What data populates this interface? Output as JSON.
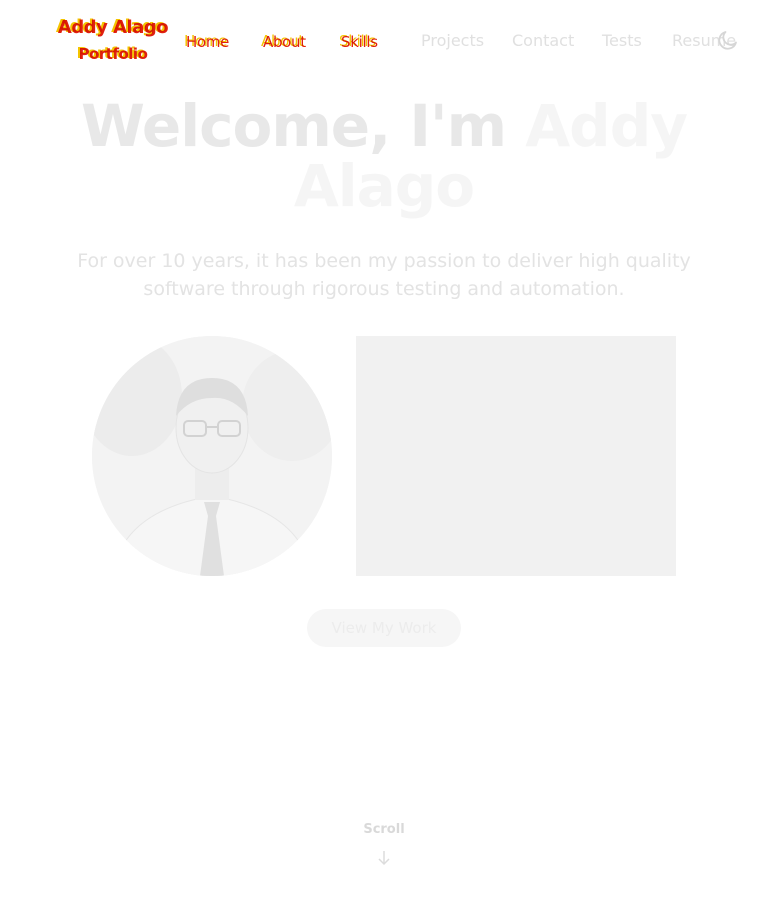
{
  "header": {
    "logo": {
      "line1": "Addy Alago",
      "line2": "Portfolio"
    },
    "nav": [
      {
        "label": "Home"
      },
      {
        "label": "About"
      },
      {
        "label": "Skills"
      },
      {
        "label": "Projects"
      },
      {
        "label": "Contact"
      },
      {
        "label": "Tests"
      },
      {
        "label": "Resume"
      }
    ],
    "theme_toggle_icon": "moon-icon"
  },
  "hero": {
    "title_prefix": "Welcome, I'm ",
    "title_name": "Addy Alago",
    "subtitle": "For over 10 years, it has been my passion to deliver high quality software through rigorous testing and automation.",
    "cta_label": "View My Work"
  },
  "scroll": {
    "label": "Scroll",
    "icon": "arrow-down-icon"
  },
  "colors": {
    "logo_primary": "#f4c400",
    "logo_shadow": "#e02010",
    "nav_faded": "#e0e0e0",
    "title_faded": "#e8e8e8"
  }
}
